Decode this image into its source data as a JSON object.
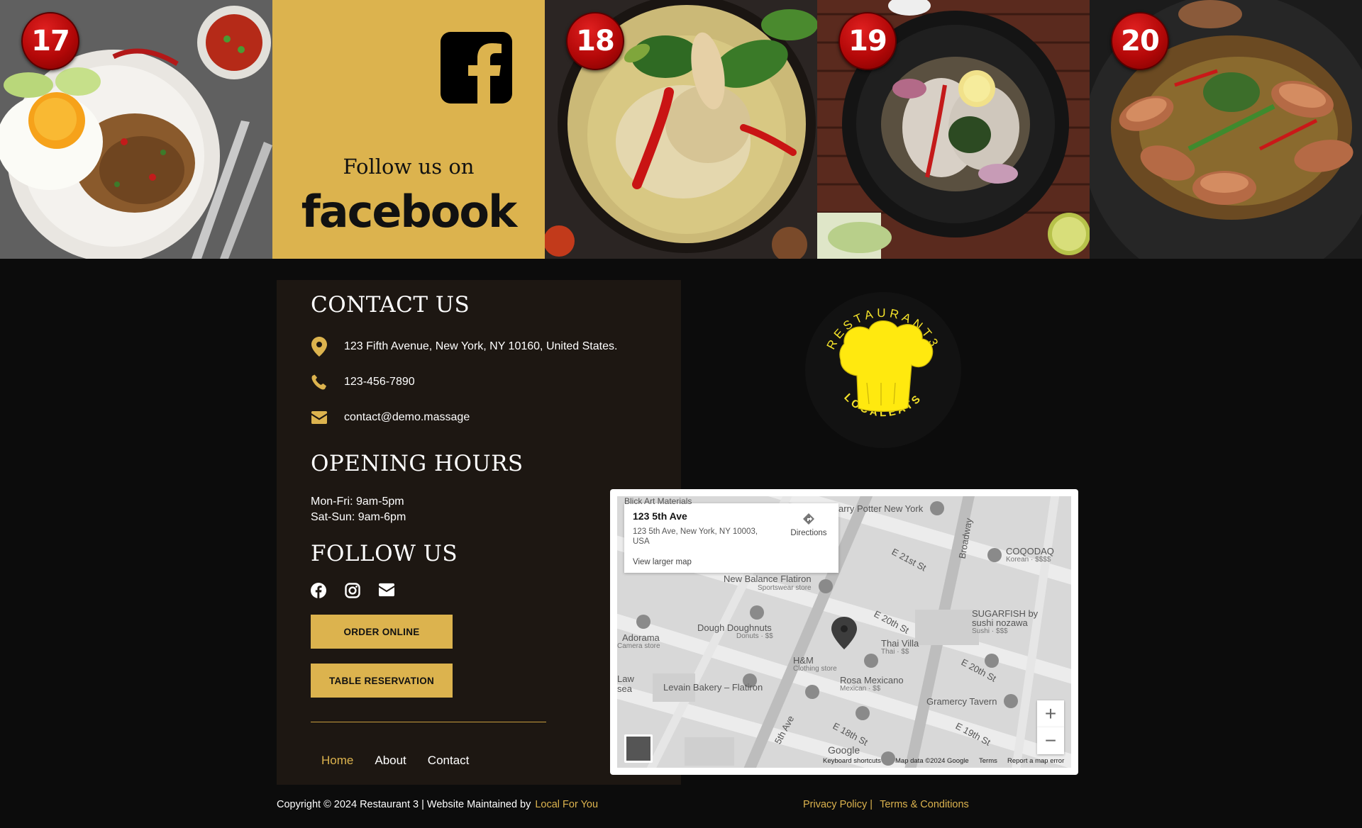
{
  "gallery": {
    "badges": [
      "17",
      "18",
      "19",
      "20"
    ],
    "facebook": {
      "follow_text": "Follow us on",
      "brand_word": "facebook"
    }
  },
  "contact": {
    "heading": "CONTACT US",
    "address": "123 Fifth Avenue, New York, NY 10160, United States.",
    "phone": "123-456-7890",
    "email": "contact@demo.massage",
    "icons": [
      "map-pin-icon",
      "phone-icon",
      "envelope-icon"
    ]
  },
  "hours": {
    "heading": "OPENING HOURS",
    "weekday": "Mon-Fri: 9am-5pm",
    "weekend": "Sat-Sun: 9am-6pm"
  },
  "follow": {
    "heading": "FOLLOW US",
    "icons": [
      "facebook-icon",
      "instagram-icon",
      "mail-icon"
    ]
  },
  "buttons": {
    "order": "ORDER ONLINE",
    "reservation": "TABLE RESERVATION"
  },
  "nav": {
    "home": "Home",
    "about": "About",
    "contact": "Contact"
  },
  "logo": {
    "top_text": "RESTAURANT3",
    "bottom_text": "LOCALEATS"
  },
  "map": {
    "place_name": "123 5th Ave",
    "place_address": "123 5th Ave, New York, NY 10003, USA",
    "directions": "Directions",
    "view_larger": "View larger map",
    "labels": {
      "blick": "Blick Art Materials",
      "harry": "arry Potter New York",
      "coqodaq": "COQODAQ",
      "coqodaq_sub": "Korean · $$$$",
      "e21": "E 21st St",
      "broadway": "Broadway",
      "newbalance": "New Balance Flatiron",
      "newbalance_sub": "Sportswear store",
      "sugarfish": "SUGARFISH by",
      "sugarfish2": "sushi nozawa",
      "sugarfish_sub": "Sushi · $$$",
      "e20a": "E 20th St",
      "dough": "Dough Doughnuts",
      "dough_sub": "Donuts · $$",
      "adorama": "Adorama",
      "adorama_sub": "Camera store",
      "thaivilla": "Thai Villa",
      "thaivilla_sub": "Thai · $$",
      "hm": "H&M",
      "hm_sub": "Clothing store",
      "e20b": "E 20th St",
      "law": "Law",
      "sea": "sea",
      "levain": "Levain Bakery – Flatiron",
      "rosa": "Rosa Mexicano",
      "rosa_sub": "Mexican · $$",
      "gramercy": "Gramercy Tavern",
      "fifth": "5th Ave",
      "e18": "E 18th St",
      "e19": "E 19th St"
    },
    "attribution": {
      "google": "Google",
      "shortcuts": "Keyboard shortcuts",
      "data": "Map data ©2024 Google",
      "terms": "Terms",
      "report": "Report a map error"
    },
    "zoom_in": "+",
    "zoom_out": "−"
  },
  "footer": {
    "copyright": "Copyright © 2024 Restaurant 3 | Website Maintained by",
    "maintainer": "Local For You",
    "privacy": "Privacy Policy |",
    "terms": "Terms & Conditions"
  },
  "colors": {
    "gold": "#dcb34e",
    "panel": "#1d1712",
    "page": "#0c0c0c",
    "badge": "#c00d0d"
  }
}
